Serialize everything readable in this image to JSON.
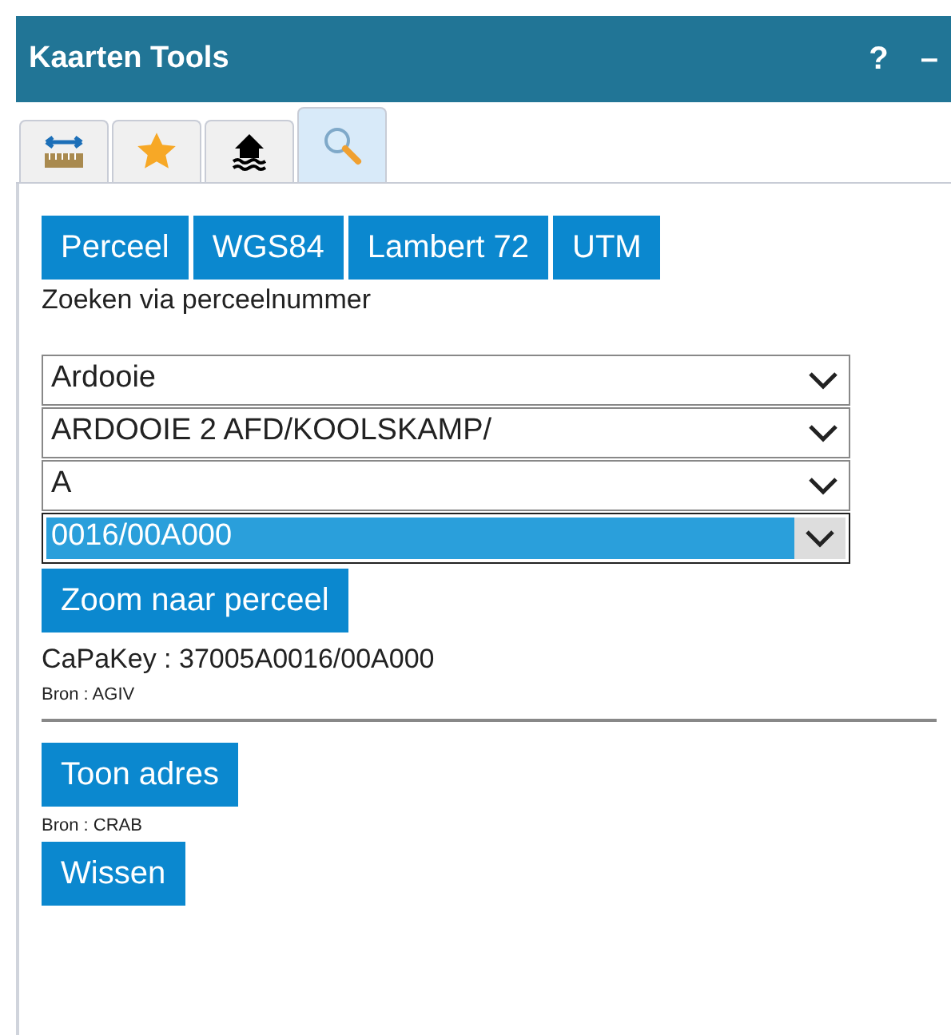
{
  "window": {
    "title": "Kaarten Tools",
    "help": "?",
    "minimize": "–"
  },
  "tabs": [
    {
      "kind": "measure",
      "selected": false
    },
    {
      "kind": "star",
      "selected": false
    },
    {
      "kind": "flood",
      "selected": false
    },
    {
      "kind": "search",
      "selected": true
    }
  ],
  "mode_buttons": [
    "Perceel",
    "WGS84",
    "Lambert 72",
    "UTM"
  ],
  "subtitle": "Zoeken via perceelnummer",
  "selects": [
    {
      "value": "Ardooie",
      "focused": false
    },
    {
      "value": "ARDOOIE 2 AFD/KOOLSKAMP/",
      "focused": false
    },
    {
      "value": "A",
      "focused": false
    },
    {
      "value": "0016/00A000",
      "focused": true
    }
  ],
  "zoom_button": "Zoom naar perceel",
  "capakey": "CaPaKey : 37005A0016/00A000",
  "source_1": "Bron : AGIV",
  "address_button": "Toon adres",
  "source_2": "Bron : CRAB",
  "clear_button": "Wissen"
}
